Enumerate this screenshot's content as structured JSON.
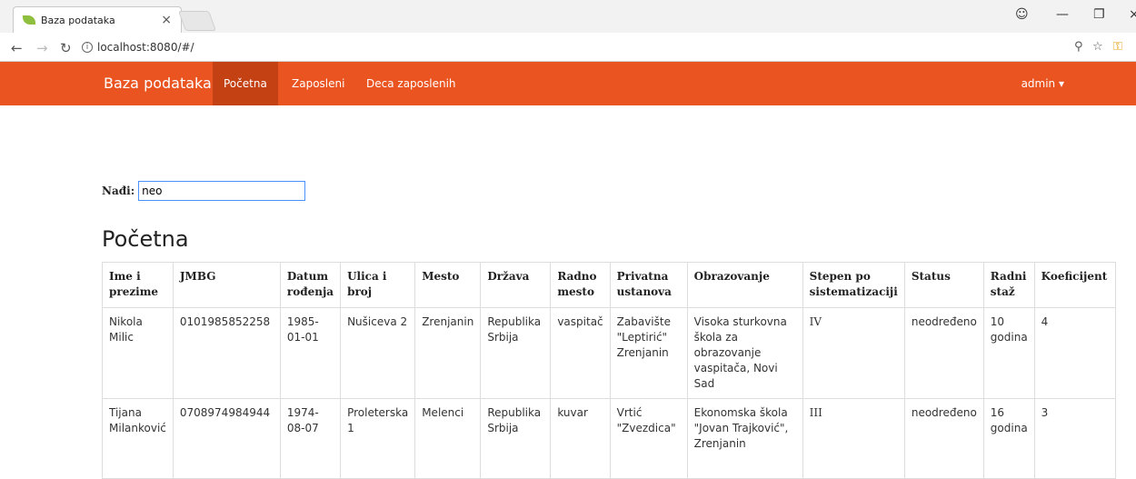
{
  "browser": {
    "tab_title": "Baza podataka",
    "tab_close": "×",
    "url": "localhost:8080/#/"
  },
  "navbar": {
    "brand": "Baza podataka",
    "links": [
      "Početna",
      "Zaposleni",
      "Deca zaposlenih"
    ],
    "active_index": 0,
    "user_menu": "admin ▾",
    "color": "#e95420"
  },
  "search": {
    "label": "Nađi:",
    "value": "neo"
  },
  "page_title": "Početna",
  "table": {
    "headers": [
      "Ime i prezime",
      "JMBG",
      "Datum rođenja",
      "Ulica i broj",
      "Mesto",
      "Država",
      "Radno mesto",
      "Privatna ustanova",
      "Obrazovanje",
      "Stepen po sistematizaciji",
      "Status",
      "Radni staž",
      "Koeficijent"
    ],
    "rows": [
      [
        "Nikola Milic",
        "0101985852258",
        "1985-01-01",
        "Nušiceva 2",
        "Zrenjanin",
        "Republika Srbija",
        "vaspitač",
        "Zabavište \"Leptirić\" Zrenjanin",
        "Visoka sturkovna škola za obrazovanje vaspitača, Novi Sad",
        "IV",
        "neodređeno",
        "10 godina",
        "4"
      ],
      [
        "Tijana Milanković",
        "0708974984944",
        "1974-08-07",
        "Proleterska 1",
        "Melenci",
        "Republika Srbija",
        "kuvar",
        "Vrtić \"Zvezdica\"",
        "Ekonomska škola \"Jovan Trajković\", Zrenjanin",
        "III",
        "neodređeno",
        "16 godina",
        "3"
      ]
    ]
  }
}
